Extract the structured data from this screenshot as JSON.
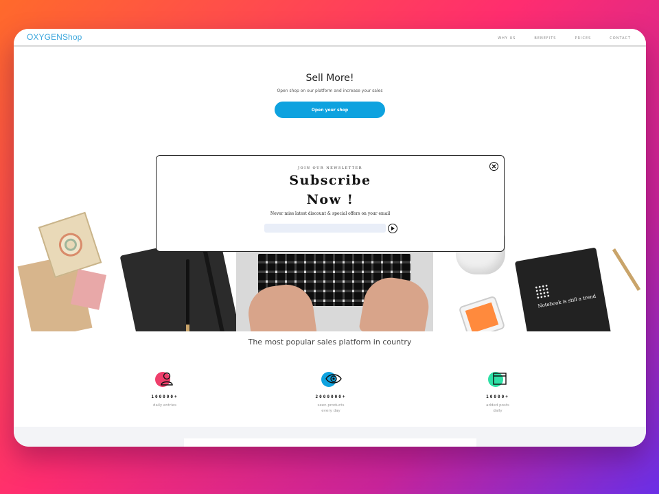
{
  "header": {
    "logo": "OXYGENShop",
    "nav": [
      "WHY US",
      "BENEFITS",
      "PRICES",
      "CONTACT"
    ]
  },
  "hero": {
    "title": "Sell More!",
    "subtitle": "Open shop on our platform and increase your sales",
    "cta": "Open your shop"
  },
  "desk_photo": {
    "notebook_text": "Notebook is still a trend"
  },
  "tagline": "The most popular sales platform in country",
  "stats": [
    {
      "icon": "user-icon",
      "value": "100000+",
      "label_line1": "daily entries",
      "label_line2": "",
      "accent": "#ef3f6c"
    },
    {
      "icon": "eye-icon",
      "value": "2000000+",
      "label_line1": "seen products",
      "label_line2": "every day",
      "accent": "#0ea2df"
    },
    {
      "icon": "browser-window-icon",
      "value": "10000+",
      "label_line1": "added posts",
      "label_line2": "daily",
      "accent": "#2fe0a6"
    }
  ],
  "modal": {
    "eyebrow": "Join our newsletter",
    "title_line1": "Subscribe",
    "title_line2": "Now !",
    "description": "Never miss latest discount & special offers on your email",
    "email_placeholder": ""
  },
  "colors": {
    "accent": "#0ea2df",
    "logo": "#3aa6dc"
  }
}
